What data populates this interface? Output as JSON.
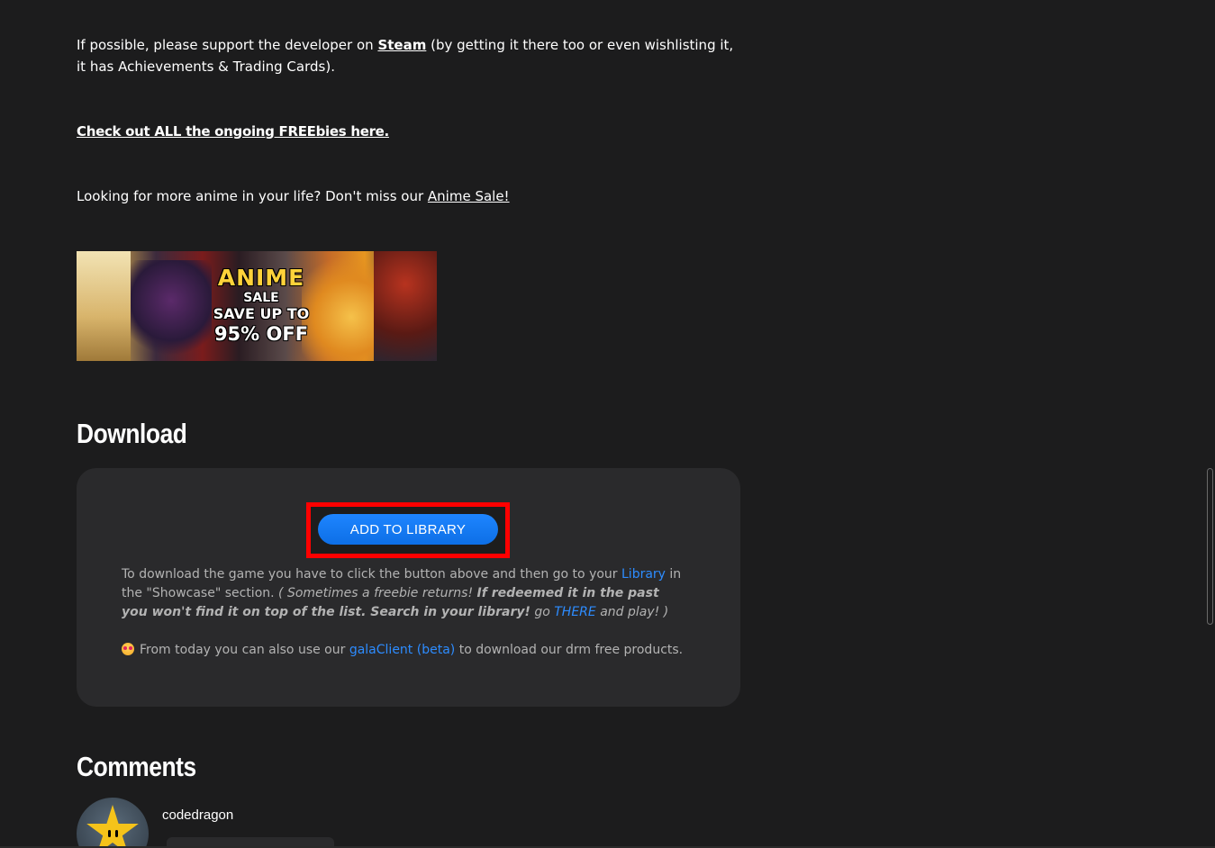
{
  "intro": {
    "steam_prefix": "If possible, please support the developer on ",
    "steam_link": "Steam",
    "steam_suffix": " (by getting it there too or even wishlisting it, it has Achievements & Trading Cards).",
    "freebies_link": "Check out ALL the ongoing FREEbies here.",
    "anime_prefix": "Looking for more anime in your life? Don't miss our ",
    "anime_link": "Anime Sale!"
  },
  "banner": {
    "line1": "ANIME",
    "line2": "SALE",
    "line3": "SAVE UP TO",
    "line4": "95% OFF"
  },
  "download": {
    "heading": "Download",
    "button_label": "ADD TO LIBRARY",
    "text_1": "To download the game you have to click the button above and then go to your ",
    "library_link": "Library",
    "text_2": " in the \"Showcase\" section. ",
    "text_italic_1": "( Sometimes a freebie returns! ",
    "text_bold_italic": "If redeemed it in the past you won't find it on top of the list. Search in your library!",
    "text_italic_2": " go ",
    "there_link": "THERE",
    "text_italic_3": " and play! )",
    "client_prefix": "From today you can also use our ",
    "client_link": "galaClient (beta)",
    "client_suffix": " to download our drm free products.",
    "emoji_icon": "star-struck-emoji-icon"
  },
  "comments": {
    "heading": "Comments",
    "items": [
      {
        "username": "codedragon",
        "avatar_icon": "star-avatar-icon"
      }
    ]
  },
  "colors": {
    "background": "#1c1c1d",
    "panel": "#2a2a2c",
    "accent_button": "#1a73e8",
    "link_blue": "#2d8cff",
    "highlight_border": "#ff0000"
  }
}
